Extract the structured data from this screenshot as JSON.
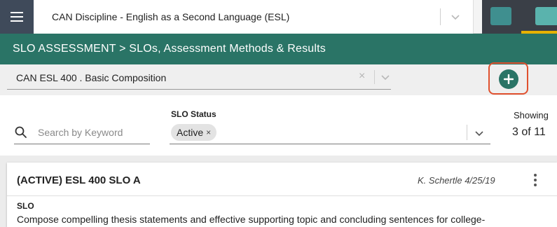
{
  "topbar": {
    "discipline": "CAN Discipline - English as a Second Language (ESL)"
  },
  "header": {
    "breadcrumb": "SLO ASSESSMENT > SLOs, Assessment Methods & Results"
  },
  "course": {
    "selected": "CAN ESL 400 . Basic Composition",
    "clear_glyph": "×"
  },
  "filters": {
    "search_placeholder": "Search by Keyword",
    "status_label": "SLO Status",
    "status_chip": "Active",
    "chip_remove_glyph": "×"
  },
  "showing": {
    "label": "Showing",
    "count": "3 of 11"
  },
  "card": {
    "title": "(ACTIVE) ESL 400 SLO A",
    "author": "K. Schertle 4/25/19",
    "section_label": "SLO",
    "description": "Compose compelling thesis statements and effective supporting topic and concluding sentences for college-"
  },
  "colors": {
    "header_green": "#2a7466",
    "add_outline": "#e0502e",
    "accent_yellow": "#e6b100",
    "teal": "#3f8f8f"
  },
  "icons": {
    "menu": "hamburger-icon",
    "chevron": "chevron-down-icon",
    "add": "plus-circle-icon",
    "search": "search-icon",
    "more": "kebab-menu-icon"
  }
}
